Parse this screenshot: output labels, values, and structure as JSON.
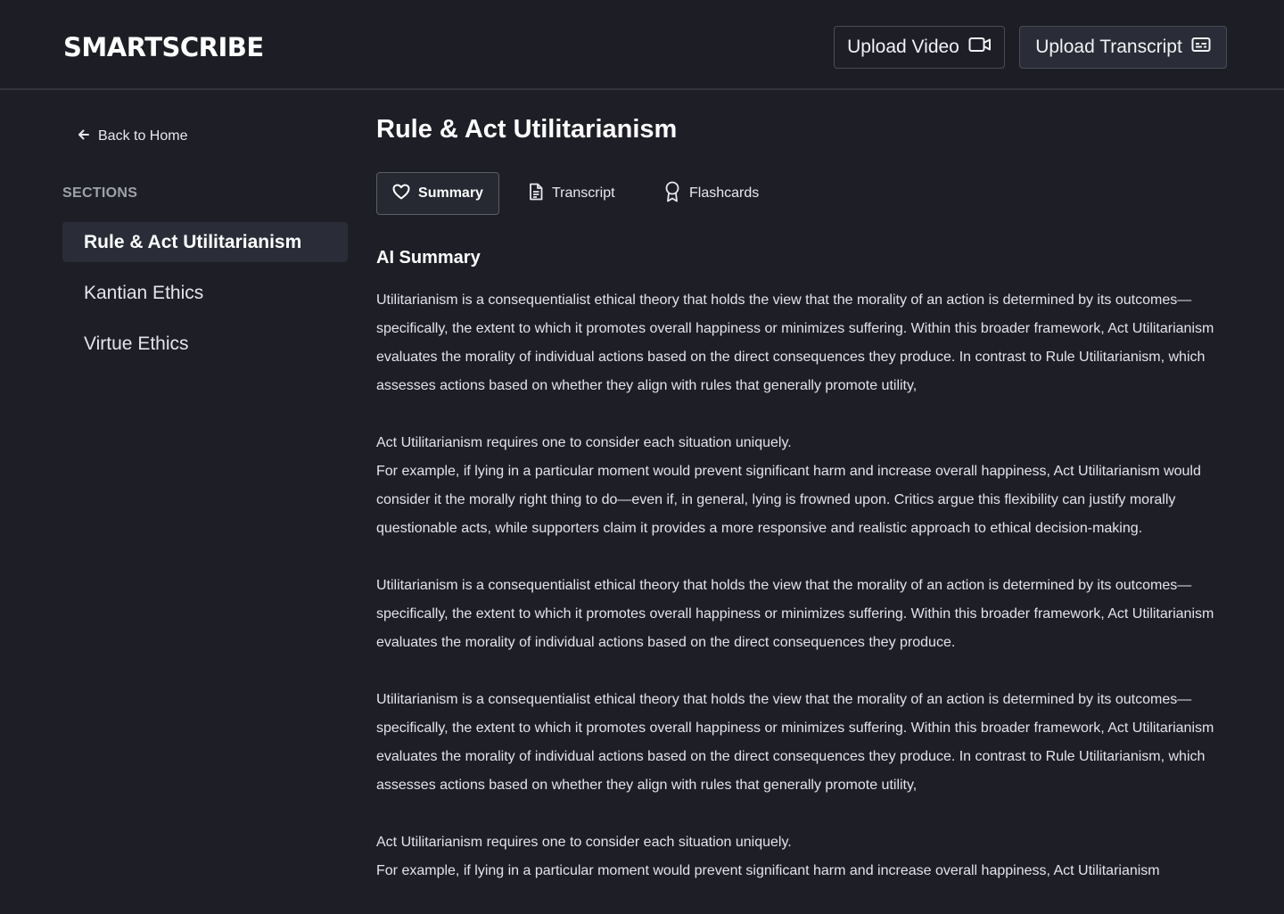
{
  "app": {
    "logo": "SMARTSCRIBE"
  },
  "header": {
    "upload_video_label": "Upload Video",
    "upload_transcript_label": "Upload Transcript"
  },
  "sidebar": {
    "back_label": "Back to Home",
    "sections_label": "SECTIONS",
    "items": [
      {
        "label": "Rule & Act Utilitarianism",
        "active": true
      },
      {
        "label": "Kantian Ethics",
        "active": false
      },
      {
        "label": "Virtue Ethics",
        "active": false
      }
    ]
  },
  "main": {
    "title": "Rule & Act Utilitarianism",
    "tabs": [
      {
        "label": "Summary",
        "icon": "heart-icon",
        "active": true
      },
      {
        "label": "Transcript",
        "icon": "document-icon",
        "active": false
      },
      {
        "label": "Flashcards",
        "icon": "award-icon",
        "active": false
      }
    ],
    "section_title": "AI Summary",
    "paragraphs": [
      "Utilitarianism is a consequentialist ethical theory that holds the view that the morality of an action is determined by its outcomes—specifically, the extent to which it promotes overall happiness or minimizes suffering. Within this broader framework, Act Utilitarianism evaluates the morality of individual actions based on the direct consequences they produce. In contrast to Rule Utilitarianism, which assesses actions based on whether they align with rules that generally promote utility,",
      "Act Utilitarianism requires one to consider each situation uniquely.",
      "For example, if lying in a particular moment would prevent significant harm and increase overall happiness, Act Utilitarianism would consider it the morally right thing to do—even if, in general, lying is frowned upon. Critics argue this flexibility can justify morally questionable acts, while supporters claim it provides a more responsive and realistic approach to ethical decision-making.",
      "Utilitarianism is a consequentialist ethical theory that holds the view that the morality of an action is determined by its outcomes—specifically, the extent to which it promotes overall happiness or minimizes suffering. Within this broader framework, Act Utilitarianism evaluates the morality of individual actions based on the direct consequences they produce.",
      "Utilitarianism is a consequentialist ethical theory that holds the view that the morality of an action is determined by its outcomes—specifically, the extent to which it promotes overall happiness or minimizes suffering. Within this broader framework, Act Utilitarianism evaluates the morality of individual actions based on the direct consequences they produce. In contrast to Rule Utilitarianism, which assesses actions based on whether they align with rules that generally promote utility,",
      "Act Utilitarianism requires one to consider each situation uniquely.",
      "For example, if lying in a particular moment would prevent significant harm and increase overall happiness, Act Utilitarianism"
    ]
  }
}
